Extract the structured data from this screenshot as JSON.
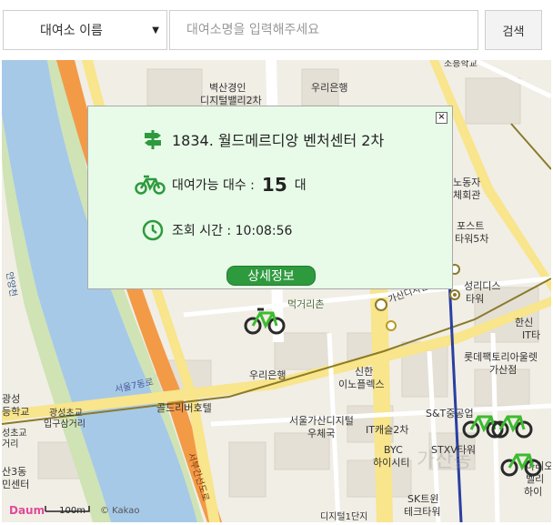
{
  "search": {
    "select_value": "대여소 이름",
    "placeholder": "대여소명을 입력해주세요",
    "button_label": "검색"
  },
  "popup": {
    "station_name": "1834. 월드메르디앙 벤처센터 2차",
    "count_label": "대여가능 대수 :",
    "count_value": "15",
    "count_unit": "대",
    "time_label": "조회 시간 : 10:08:56",
    "detail_button": "상세정보",
    "close_symbol": "×"
  },
  "map": {
    "labels": {
      "l1": "벽산경인",
      "l2": "디지털밸리2차",
      "l3": "우리은행",
      "l4": "조흥학교",
      "l5": "먹거리촌",
      "l6": "우리은행",
      "l7": "신한",
      "l8": "이노플렉스",
      "l9": "골드리버호텔",
      "l10": "서울가산디지털",
      "l11": "우체국",
      "l12": "IT캐슬2차",
      "l13": "BYC",
      "l14": "하이시티",
      "l15": "STXV타워",
      "l16": "S&T중공업",
      "l17": "롯데팩토리아울렛",
      "l18": "가산점",
      "l19": "한신",
      "l20": "IT타",
      "l21": "마리오",
      "l22": "타워",
      "l23": "성리디스",
      "l24": "포스트",
      "l25": "타워5차",
      "l26": "노동자",
      "l27": "체회관",
      "l28": "광성초교",
      "l29": "입구삼거리",
      "l30": "광성",
      "l31": "등학교",
      "l32": "성초교",
      "l33": "거리",
      "l34": "산3동",
      "l35": "민센터",
      "l36": "SK트윈",
      "l37": "테크타워",
      "l38": "디지털1단지",
      "l39": "남부순환로",
      "l40": "서울7동로",
      "l41": "서부간선도로",
      "l42": "가산디지털",
      "l43": "벨리",
      "l44": "하이",
      "l45": "안양천",
      "l46": "가산동"
    },
    "scale_label": "100m",
    "logo_text": "Daum",
    "copyright": "© Kakao",
    "watermark": "가산동"
  },
  "colors": {
    "popup_bg": "#e8fbe8",
    "accent_green": "#2e9a3e",
    "river": "#a6c9e8",
    "highway": "#f39a47"
  }
}
